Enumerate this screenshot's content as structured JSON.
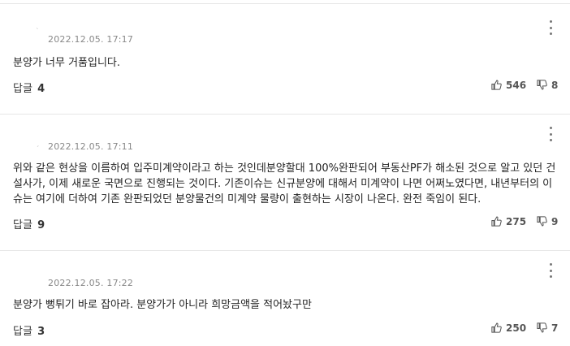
{
  "comments": [
    {
      "timestamp": "2022.12.05. 17:17",
      "text": "분양가 너무 거품입니다.",
      "reply_label": "답글",
      "reply_count": "4",
      "like_count": "546",
      "dislike_count": "8"
    },
    {
      "timestamp": "2022.12.05. 17:11",
      "text": "위와 같은 현상을 이름하여 입주미계약이라고 하는 것인데분양할대 100%완판되어 부동산PF가 해소된 것으로 알고 있던 건설사가, 이제 새로운 국면으로 진행되는 것이다. 기존이슈는 신규분양에 대해서 미계약이 나면 어쩌노였다면, 내년부터의 이슈는 여기에 더하여 기존 완판되었던 분양물건의 미계약 물량이 출현하는 시장이 나온다. 완전 죽임이 된다.",
      "reply_label": "답글",
      "reply_count": "9",
      "like_count": "275",
      "dislike_count": "9"
    },
    {
      "timestamp": "2022.12.05. 17:22",
      "text": "분양가 뻥튀기 바로 잡아라. 분양가가 아니라 희망금액을 적어놨구만",
      "reply_label": "답글",
      "reply_count": "3",
      "like_count": "250",
      "dislike_count": "7"
    }
  ],
  "icons": {
    "thumb_up": "thumb-up-icon",
    "thumb_down": "thumb-down-icon",
    "more": "more-vertical-icon"
  },
  "colors": {
    "text": "#222222",
    "meta": "#888888",
    "divider": "#e6e6e6"
  }
}
